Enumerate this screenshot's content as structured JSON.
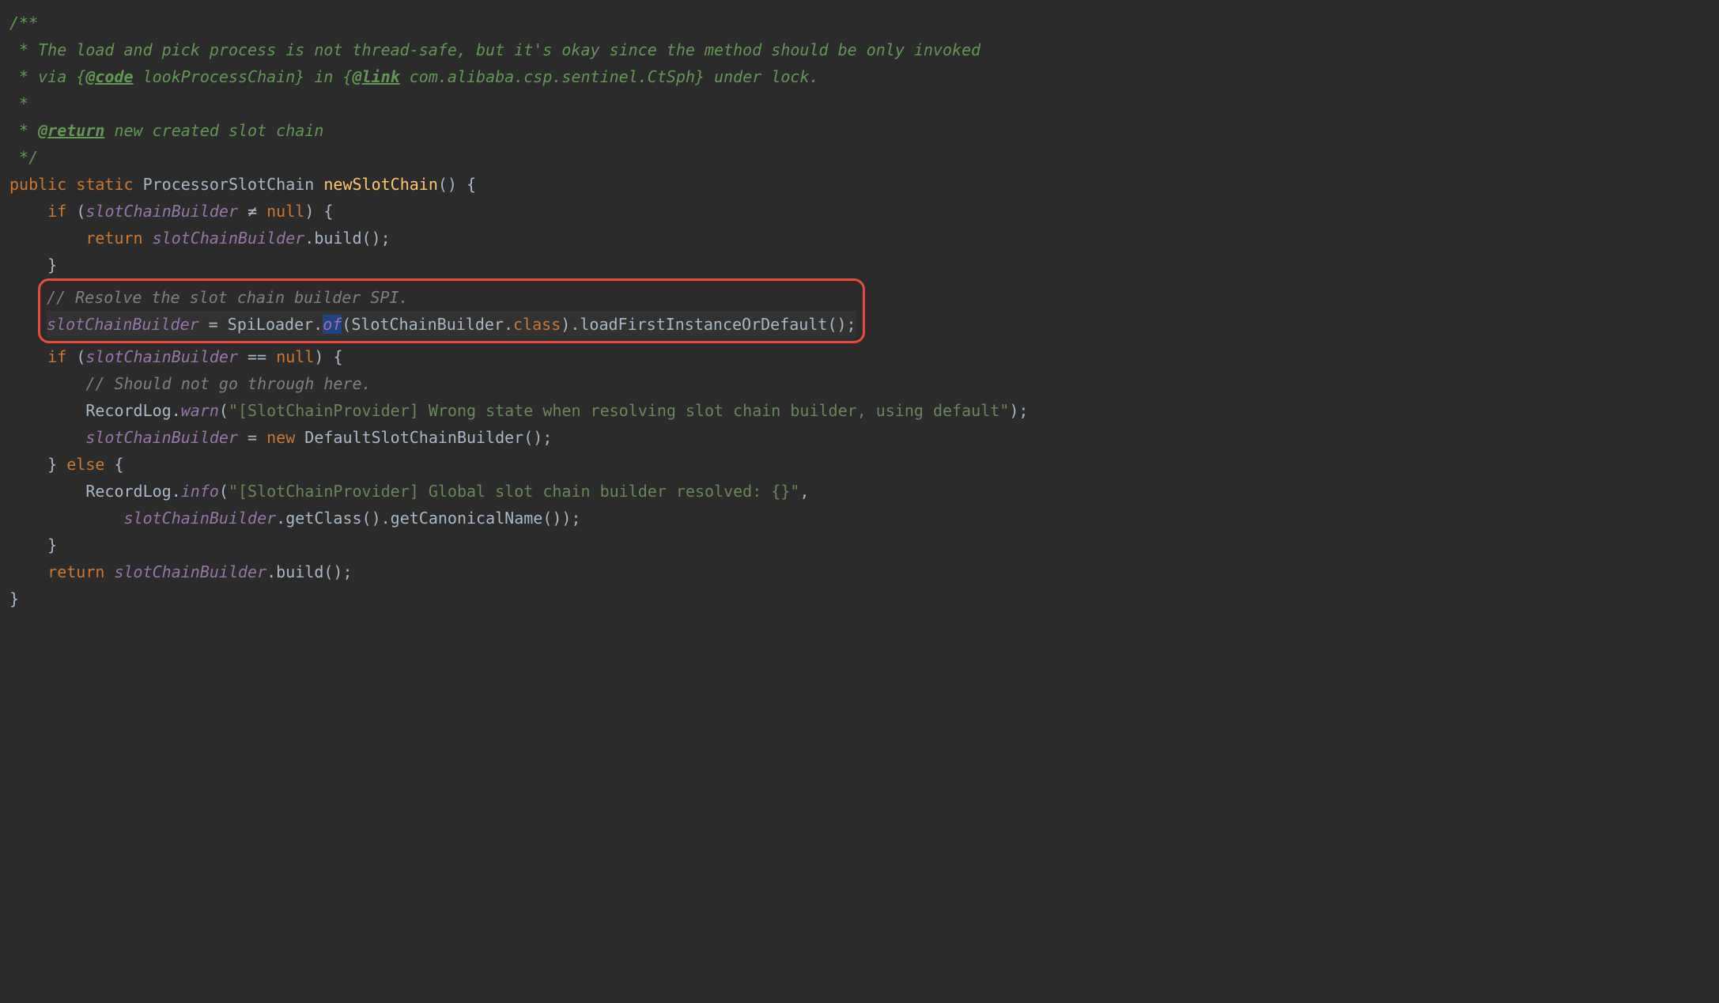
{
  "code": {
    "doc_open": "/**",
    "doc_line1_a": " * The load and pick process is not thread-safe, but it's okay since the method should be only invoked",
    "doc_line2_a": " * via {",
    "doc_line2_tag": "@code",
    "doc_line2_b": " lookProcessChain} in {",
    "doc_line2_tag2": "@link",
    "doc_line2_c": " com.alibaba.csp.sentinel.CtSph} under lock.",
    "doc_line3": " *",
    "doc_line4_a": " * ",
    "doc_line4_tag": "@return",
    "doc_line4_b": " new created slot chain",
    "doc_close": " */",
    "public": "public",
    "static": "static",
    "return_type": "ProcessorSlotChain",
    "method_name": "newSlotChain",
    "parens_open": "() {",
    "if": "if",
    "field_scb": "slotChainBuilder",
    "neq": " ≠ ",
    "null": "null",
    "paren_close_brace": ") {",
    "return": "return",
    "dot": ".",
    "build": "build",
    "call_end": "();",
    "brace_close": "}",
    "comment_resolve": "// Resolve the slot chain builder SPI.",
    "eq": " = ",
    "spiloader": "SpiLoader",
    "of": "of",
    "of_sel": "of",
    "scb_type": "SlotChainBuilder",
    "class_kw": "class",
    "loadfirst": "loadFirstInstanceOrDefault",
    "eqeq": " == ",
    "comment_should": "// Should not go through here.",
    "recordlog": "RecordLog",
    "warn": "warn",
    "string_warn": "\"[SlotChainProvider] Wrong state when resolving slot chain builder, using default\"",
    "new": "new",
    "default_scb": "DefaultSlotChainBuilder",
    "else": "else",
    "info": "info",
    "string_info": "\"[SlotChainProvider] Global slot chain builder resolved: {}\"",
    "getclass": "getClass",
    "getcanonical": "getCanonicalName",
    "paren_open": "(",
    "paren_close": ")",
    "comma": ",",
    "semi": ";",
    "brace_open": "{"
  }
}
